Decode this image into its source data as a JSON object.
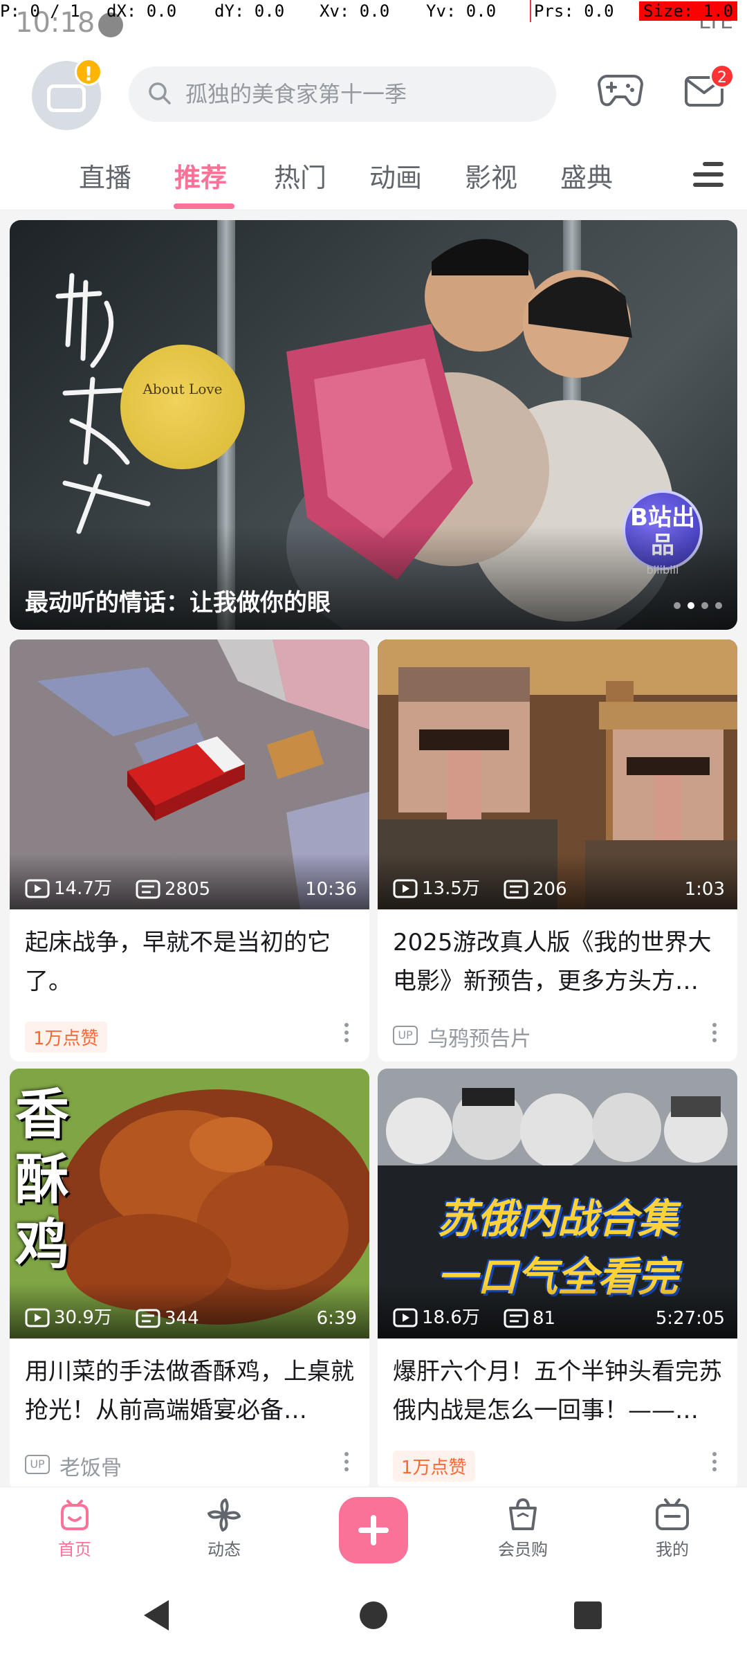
{
  "debug": {
    "p": "P: 0 / 1",
    "dx": "dX: 0.0",
    "dy": "dY: 0.0",
    "xv": "Xv: 0.0",
    "yv": "Yv: 0.0",
    "prs": "Prs: 0.0",
    "size": "Size: 1.0"
  },
  "status": {
    "time": "10:18",
    "network": "LTE"
  },
  "header": {
    "avatar_badge": "!",
    "search_placeholder": "孤独的美食家第十一季",
    "mail_count": "2",
    "icons": {
      "search": "search-icon",
      "game": "gamepad-icon",
      "mail": "mail-icon"
    }
  },
  "tabs": [
    {
      "label": "直播",
      "active": false
    },
    {
      "label": "推荐",
      "active": true
    },
    {
      "label": "热门",
      "active": false
    },
    {
      "label": "动画",
      "active": false
    },
    {
      "label": "影视",
      "active": false
    },
    {
      "label": "盛典",
      "active": false
    }
  ],
  "banner": {
    "title": "最动听的情话：让我做你的眼",
    "moon_text": "About Love",
    "seal_top": "B站出品",
    "seal_sub": "bilibili",
    "pages": 4,
    "current_page": 2
  },
  "videos": [
    {
      "views": "14.7万",
      "danmaku": "2805",
      "duration": "10:36",
      "title": "起床战争，早就不是当初的它了。",
      "like_tag": "1万点赞",
      "up": ""
    },
    {
      "views": "13.5万",
      "danmaku": "206",
      "duration": "1:03",
      "title": "2025游改真人版《我的世界大电影》新预告，更多方头方…",
      "like_tag": "",
      "up": "乌鸦预告片"
    },
    {
      "views": "30.9万",
      "danmaku": "344",
      "duration": "6:39",
      "title": "用川菜的手法做香酥鸡，上桌就抢光！从前高端婚宴必备…",
      "like_tag": "",
      "up": "老饭骨",
      "overlay": "香酥鸡"
    },
    {
      "views": "18.6万",
      "danmaku": "81",
      "duration": "5:27:05",
      "title": "爆肝六个月！五个半钟头看完苏俄内战是怎么一回事！——…",
      "like_tag": "1万点赞",
      "up": "",
      "overlay_line1": "苏俄内战合集",
      "overlay_line2": "一口气全看完"
    }
  ],
  "up_badge": "UP",
  "bottom_nav": [
    {
      "label": "首页",
      "active": true
    },
    {
      "label": "动态",
      "active": false
    },
    {
      "label": "会员购",
      "active": false
    },
    {
      "label": "我的",
      "active": false
    }
  ],
  "colors": {
    "accent": "#fb7299",
    "like": "#ff6633"
  }
}
